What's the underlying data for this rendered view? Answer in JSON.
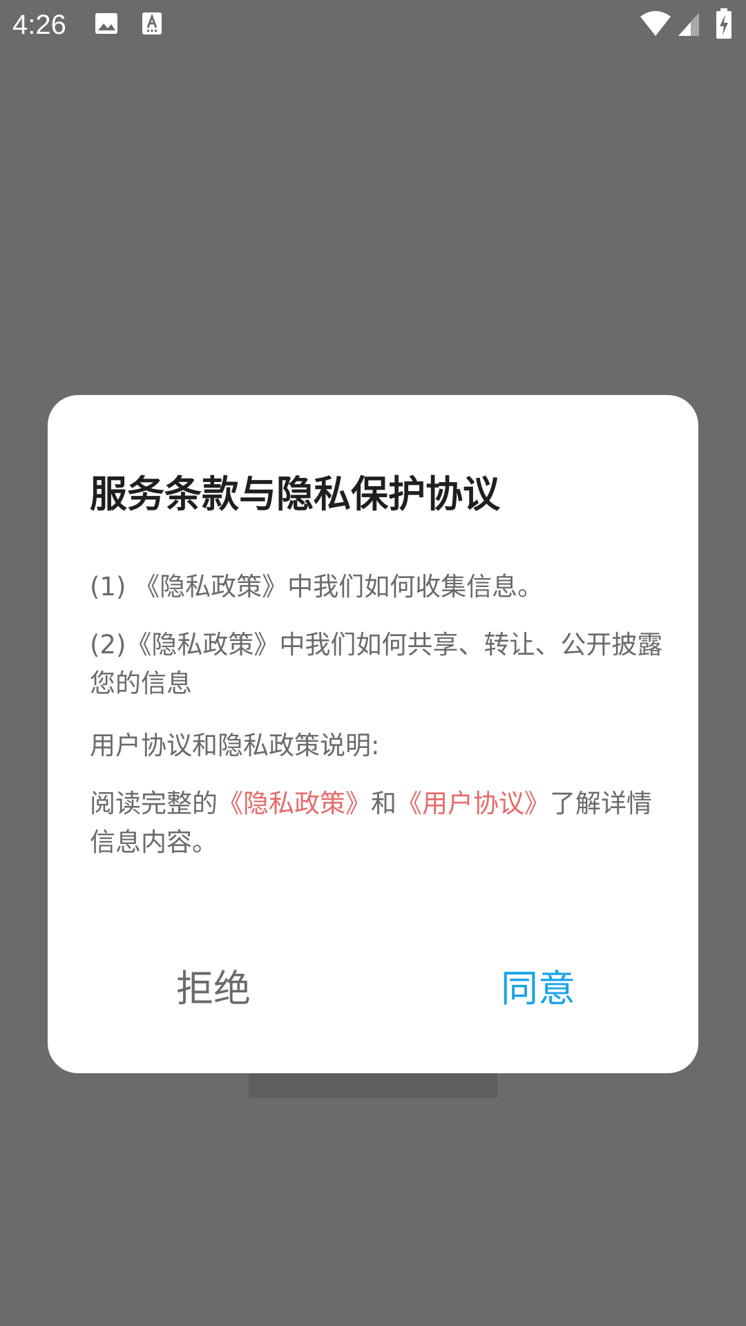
{
  "status_bar": {
    "time": "4:26",
    "icons": [
      "image-icon",
      "text-a-icon",
      "wifi-icon",
      "cell-signal-icon",
      "battery-charging-icon"
    ]
  },
  "dialog": {
    "title": "服务条款与隐私保护协议",
    "item1": "(1) 《隐私政策》中我们如何收集信息。",
    "item2": "(2)《隐私政策》中我们如何共享、转让、公开披露您的信息",
    "section_heading": "用户协议和隐私政策说明:",
    "read_prefix": "阅读完整的",
    "privacy_link": "《隐私政策》",
    "and_text": "和",
    "user_agreement_link": "《用户协议》",
    "read_suffix": "了解详情信息内容。",
    "refuse_label": "拒绝",
    "agree_label": "同意"
  },
  "colors": {
    "backdrop": "#6b6b6b",
    "dialog_bg": "#ffffff",
    "link": "#e66a6a",
    "agree": "#1aa3e8",
    "body_text": "#6a6a6a",
    "title_text": "#1f1f1f"
  }
}
